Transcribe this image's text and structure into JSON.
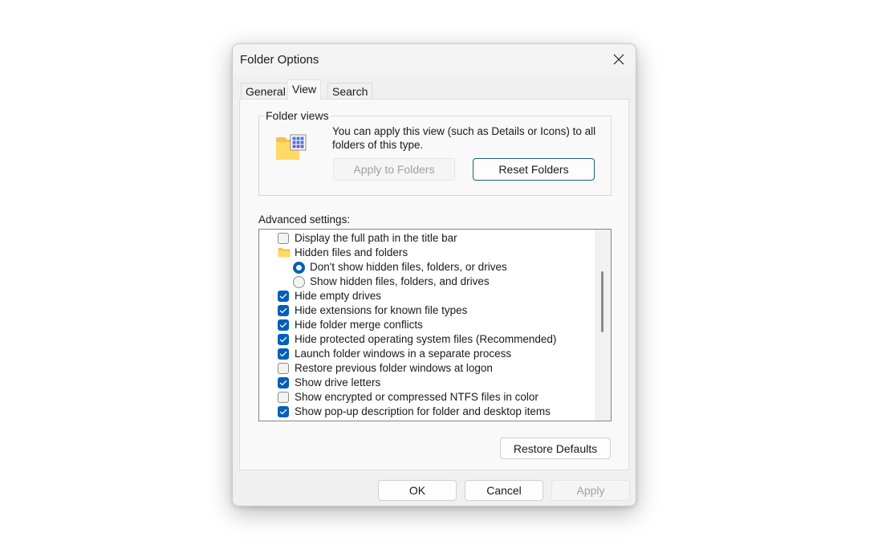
{
  "window": {
    "title": "Folder Options",
    "close_icon": "close-icon"
  },
  "tabs": [
    {
      "label": "General",
      "active": false
    },
    {
      "label": "View",
      "active": true
    },
    {
      "label": "Search",
      "active": false
    }
  ],
  "folder_views": {
    "legend": "Folder views",
    "icon": "folder-view-icon",
    "description": "You can apply this view (such as Details or Icons) to all folders of this type.",
    "apply_button": {
      "label": "Apply to Folders",
      "enabled": false
    },
    "reset_button": {
      "label": "Reset Folders",
      "enabled": true
    }
  },
  "advanced": {
    "label": "Advanced settings:",
    "items": [
      {
        "type": "checkbox",
        "level": 0,
        "checked": false,
        "label": "Display the full path in the title bar"
      },
      {
        "type": "folder",
        "level": 0,
        "label": "Hidden files and folders"
      },
      {
        "type": "radio",
        "level": 1,
        "checked": true,
        "label": "Don't show hidden files, folders, or drives"
      },
      {
        "type": "radio",
        "level": 1,
        "checked": false,
        "label": "Show hidden files, folders, and drives"
      },
      {
        "type": "checkbox",
        "level": 0,
        "checked": true,
        "label": "Hide empty drives"
      },
      {
        "type": "checkbox",
        "level": 0,
        "checked": true,
        "label": "Hide extensions for known file types"
      },
      {
        "type": "checkbox",
        "level": 0,
        "checked": true,
        "label": "Hide folder merge conflicts"
      },
      {
        "type": "checkbox",
        "level": 0,
        "checked": true,
        "label": "Hide protected operating system files (Recommended)"
      },
      {
        "type": "checkbox",
        "level": 0,
        "checked": true,
        "label": "Launch folder windows in a separate process"
      },
      {
        "type": "checkbox",
        "level": 0,
        "checked": false,
        "label": "Restore previous folder windows at logon"
      },
      {
        "type": "checkbox",
        "level": 0,
        "checked": true,
        "label": "Show drive letters"
      },
      {
        "type": "checkbox",
        "level": 0,
        "checked": false,
        "label": "Show encrypted or compressed NTFS files in color"
      },
      {
        "type": "checkbox",
        "level": 0,
        "checked": true,
        "label": "Show pop-up description for folder and desktop items"
      },
      {
        "type": "checkbox",
        "level": 0,
        "checked": true,
        "label": ""
      }
    ],
    "restore_defaults_label": "Restore Defaults"
  },
  "footer": {
    "ok_label": "OK",
    "cancel_label": "Cancel",
    "apply_label": "Apply",
    "apply_enabled": false
  },
  "colors": {
    "accent": "#005fb8",
    "default_button_border": "#1f5f86"
  }
}
